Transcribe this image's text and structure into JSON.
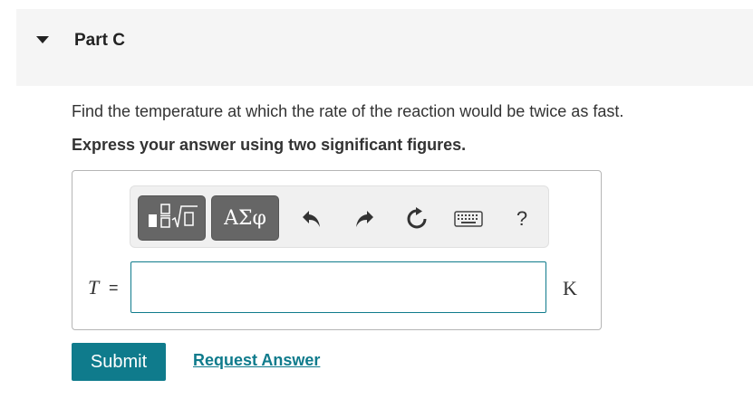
{
  "part": {
    "title": "Part C"
  },
  "question": {
    "text": "Find the temperature at which the rate of the reaction would be twice as fast.",
    "instruction": "Express your answer using two significant figures."
  },
  "toolbar": {
    "templates_icon": "fraction-sqrt-templates-icon",
    "greek_label": "ΑΣφ",
    "undo_icon": "undo-arrow-icon",
    "redo_icon": "redo-arrow-icon",
    "reset_icon": "reset-icon",
    "keyboard_icon": "keyboard-icon",
    "help_label": "?"
  },
  "answer": {
    "variable": "T",
    "equals": "=",
    "value": "",
    "unit": "K"
  },
  "actions": {
    "submit_label": "Submit",
    "request_answer_label": "Request Answer"
  },
  "colors": {
    "accent": "#0f7b8c",
    "header_bg": "#f5f5f5",
    "toolbar_button": "#666666"
  }
}
